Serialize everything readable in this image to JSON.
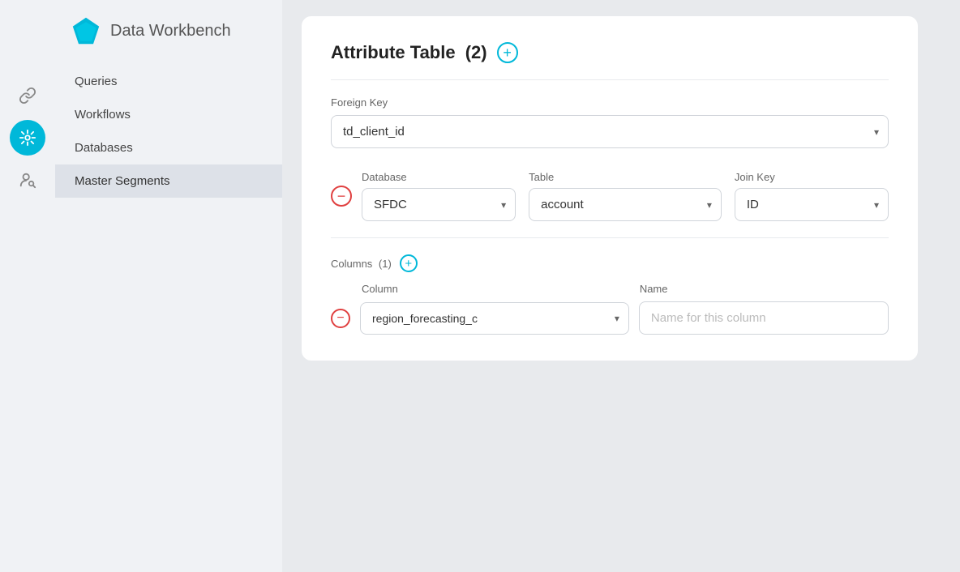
{
  "app": {
    "title": "Data Workbench",
    "logo_color": "#00b8d9"
  },
  "icon_sidebar": {
    "items": [
      {
        "name": "link-icon",
        "symbol": "⛓",
        "active": false
      },
      {
        "name": "segments-icon",
        "symbol": "✦",
        "active": true
      },
      {
        "name": "person-search-icon",
        "symbol": "👤",
        "active": false
      }
    ]
  },
  "nav": {
    "items": [
      {
        "label": "Queries",
        "active": false
      },
      {
        "label": "Workflows",
        "active": false
      },
      {
        "label": "Databases",
        "active": false
      },
      {
        "label": "Master Segments",
        "active": true
      }
    ]
  },
  "card": {
    "title": "Attribute Table",
    "count": "(2)",
    "add_btn_label": "+",
    "foreign_key_label": "Foreign Key",
    "foreign_key_value": "td_client_id",
    "foreign_key_options": [
      "td_client_id"
    ],
    "join_row": {
      "database_label": "Database",
      "database_value": "SFDC",
      "database_options": [
        "SFDC"
      ],
      "table_label": "Table",
      "table_value": "account",
      "table_options": [
        "account"
      ],
      "join_key_label": "Join Key",
      "join_key_value": "ID",
      "join_key_options": [
        "ID"
      ]
    },
    "columns": {
      "label": "Columns",
      "count": "(1)",
      "column_label": "Column",
      "column_value": "region_forecasting_c",
      "column_options": [
        "region_forecasting_c"
      ],
      "name_label": "Name",
      "name_placeholder": "Name for this column"
    }
  }
}
